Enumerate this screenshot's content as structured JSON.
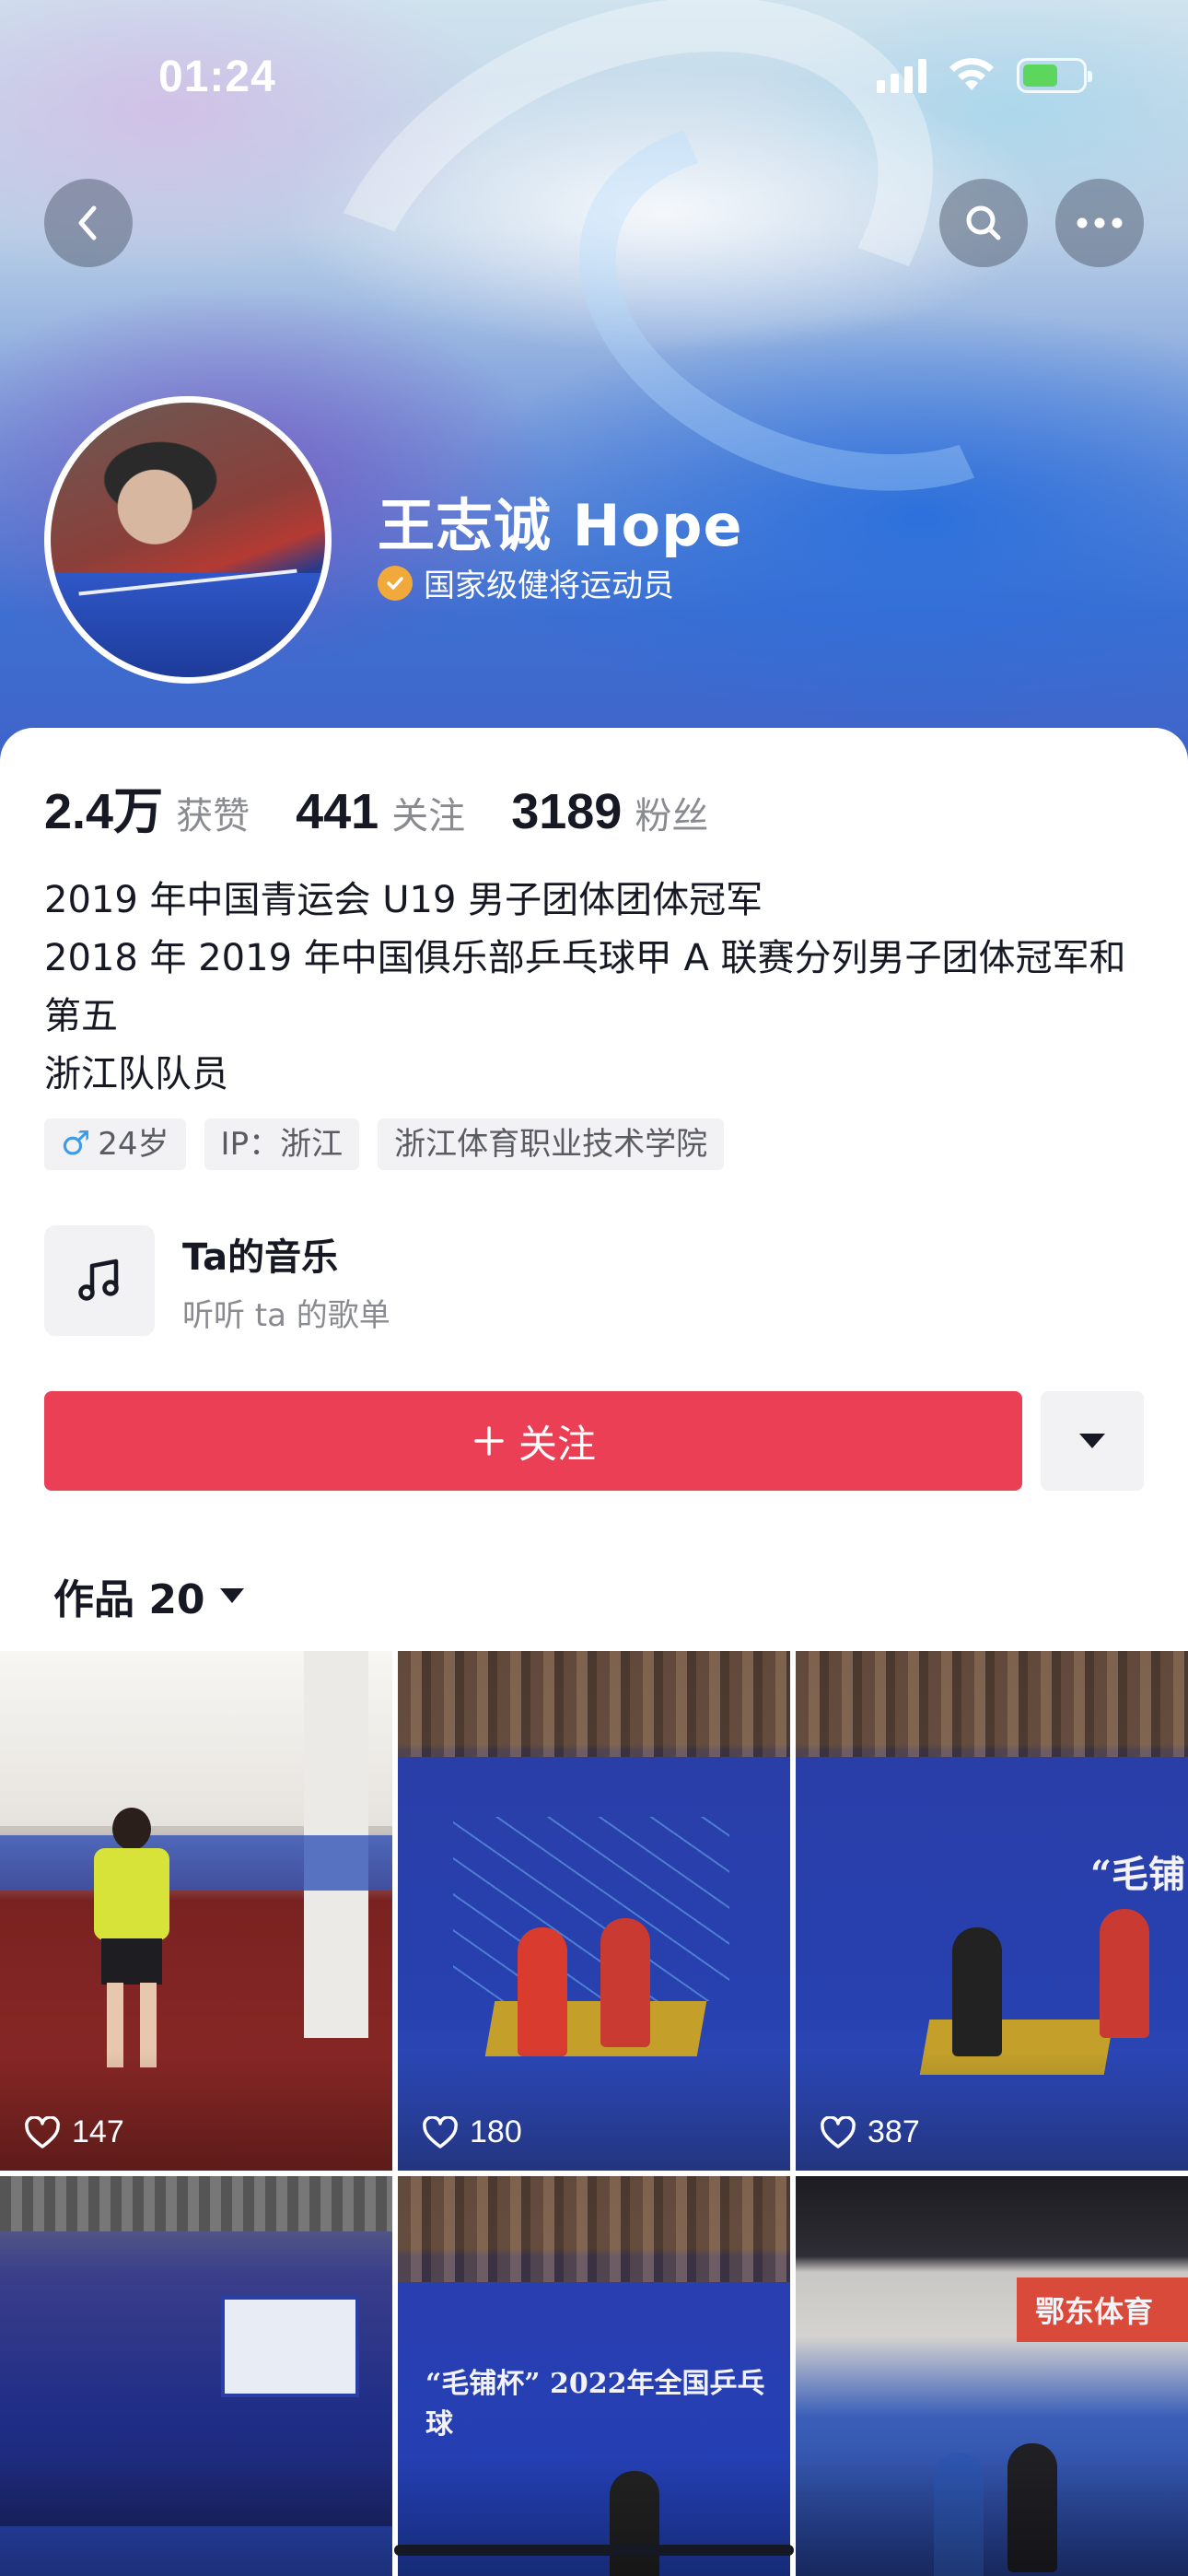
{
  "status_bar": {
    "time": "01:24"
  },
  "nav": {
    "back_icon": "chevron-left-icon",
    "search_icon": "search-icon",
    "more_icon": "more-horizontal-icon"
  },
  "profile": {
    "name": "王志诚 Hope",
    "verification": "国家级健将运动员",
    "verify_color": "#f2a93b"
  },
  "stats": [
    {
      "value": "2.4万",
      "label": "获赞"
    },
    {
      "value": "441",
      "label": "关注"
    },
    {
      "value": "3189",
      "label": "粉丝"
    }
  ],
  "bio": {
    "line1": "2019 年中国青运会 U19 男子团体团体冠军",
    "line2": "2018 年 2019 年中国俱乐部乒乓球甲 A 联赛分列男子团体冠军和",
    "line3": "第五",
    "line4": "浙江队队员"
  },
  "tags": {
    "gender_symbol": "♂",
    "age": "24岁",
    "ip": "IP：浙江",
    "school": "浙江体育职业技术学院"
  },
  "music": {
    "title": "Ta的音乐",
    "subtitle": "听听 ta 的歌单"
  },
  "actions": {
    "follow_label": "关注",
    "follow_color": "#ea3f55"
  },
  "works": {
    "label": "作品 20"
  },
  "videos": [
    {
      "likes": "147"
    },
    {
      "likes": "180"
    },
    {
      "likes": "387"
    }
  ],
  "thumbnail_text": {
    "banner_a": "“毛铺",
    "banner_b": "“毛铺杯” 2022年全国乒乓球",
    "sign_right": "鄂东体育"
  }
}
